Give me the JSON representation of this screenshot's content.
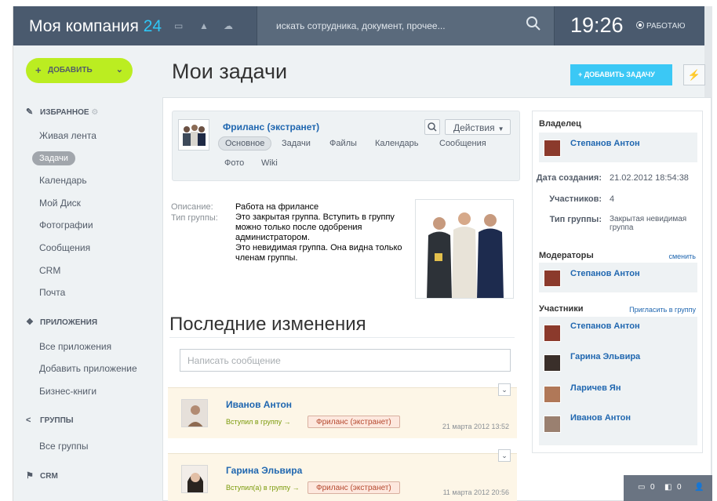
{
  "header": {
    "logo_name": "Моя компания",
    "logo_num": "24",
    "search_placeholder": "искать сотрудника, документ, прочее...",
    "clock": "19:26",
    "status": "РАБОТАЮ"
  },
  "sidebar": {
    "add_button": "ДОБАВИТЬ",
    "favorites_title": "ИЗБРАННОЕ",
    "favorites": [
      "Живая лента",
      "Задачи",
      "Календарь",
      "Мой Диск",
      "Фотографии",
      "Сообщения",
      "CRM",
      "Почта"
    ],
    "apps_title": "ПРИЛОЖЕНИЯ",
    "apps": [
      "Все приложения",
      "Добавить приложение",
      "Бизнес-книги"
    ],
    "groups_title": "ГРУППЫ",
    "groups": [
      "Все группы"
    ],
    "crm_title": "CRM"
  },
  "main": {
    "title": "Мои задачи",
    "add_task_button": "ДОБАВИТЬ ЗАДАЧУ",
    "lightning_icon": "⚡"
  },
  "group": {
    "name": "Фриланс (экстранет)",
    "tabs": [
      "Основное",
      "Задачи",
      "Файлы",
      "Календарь",
      "Сообщения",
      "Фото",
      "Wiki"
    ],
    "actions_button": "Действия",
    "description_label": "Описание:",
    "type_label": "Тип группы:",
    "description_value": "Работа на фрилансе",
    "type_value": "Это закрытая группа. Вступить в группу можно только после одобрения администратором.",
    "type_value2": "Это невидимая группа. Она видна только членам группы."
  },
  "feed": {
    "title": "Последние изменения",
    "message_placeholder": "Написать сообщение",
    "items": [
      {
        "name": "Иванов Антон",
        "action": "Вступил в группу →",
        "tag": "Фриланс (экстранет)",
        "date": "21 марта 2012 13:52"
      },
      {
        "name": "Гарина Эльвира",
        "action": "Вступил(а) в группу →",
        "tag": "Фриланс (экстранет)",
        "date": "11 марта 2012 20:56"
      }
    ]
  },
  "right": {
    "owner_title": "Владелец",
    "owner": "Степанов Антон",
    "created_label": "Дата создания:",
    "created_value": "21.02.2012 18:54:38",
    "members_label": "Участников:",
    "members_value": "4",
    "type_label": "Тип группы:",
    "type_value": "Закрытая невидимая группа",
    "moderators_title": "Модераторы",
    "change_link": "сменить",
    "moderator": "Степанов Антон",
    "participants_title": "Участники",
    "invite_link": "Пригласить в группу",
    "participants": [
      "Степанов Антон",
      "Гарина Эльвира",
      "Ларичев Ян",
      "Иванов Антон"
    ]
  },
  "bottombar": {
    "messages": "0",
    "notifications": "0"
  }
}
